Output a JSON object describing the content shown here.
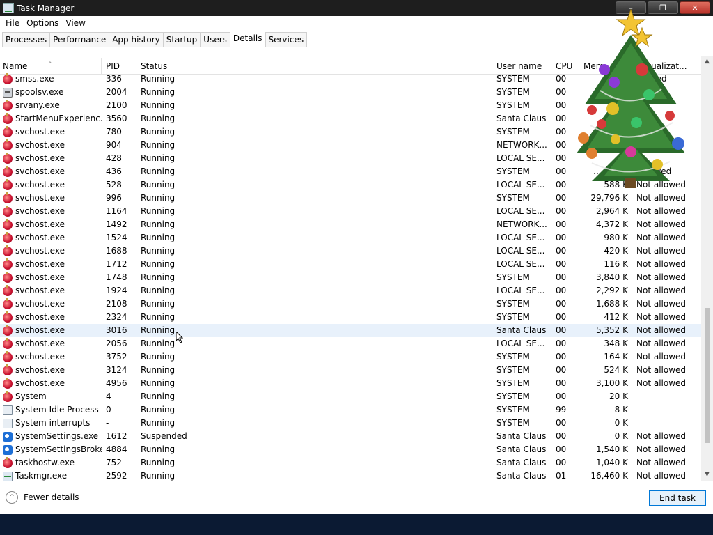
{
  "window": {
    "title": "Task Manager",
    "buttons": {
      "minimize": "–",
      "maximize": "❐",
      "close": "✕"
    }
  },
  "menu": [
    "File",
    "Options",
    "View"
  ],
  "tabs": [
    "Processes",
    "Performance",
    "App history",
    "Startup",
    "Users",
    "Details",
    "Services"
  ],
  "active_tab": "Details",
  "columns": {
    "name": "Name",
    "pid": "PID",
    "status": "Status",
    "user": "User name",
    "cpu": "CPU",
    "mem": "Mem",
    "virt": "...rtualizat..."
  },
  "rows": [
    {
      "icon": "app-icon",
      "name": "smss.exe",
      "pid": "336",
      "status": "Running",
      "user": "SYSTEM",
      "cpu": "00",
      "mem": "",
      "virt": "...owed"
    },
    {
      "icon": "printer-icon",
      "name": "spoolsv.exe",
      "pid": "2004",
      "status": "Running",
      "user": "SYSTEM",
      "cpu": "00",
      "mem": "",
      "virt": ""
    },
    {
      "icon": "app-icon",
      "name": "srvany.exe",
      "pid": "2100",
      "status": "Running",
      "user": "SYSTEM",
      "cpu": "00",
      "mem": "",
      "virt": ""
    },
    {
      "icon": "app-icon",
      "name": "StartMenuExperienc...",
      "pid": "3560",
      "status": "Running",
      "user": "Santa Claus",
      "cpu": "00",
      "mem": "",
      "virt": ""
    },
    {
      "icon": "app-icon",
      "name": "svchost.exe",
      "pid": "780",
      "status": "Running",
      "user": "SYSTEM",
      "cpu": "00",
      "mem": "",
      "virt": ""
    },
    {
      "icon": "app-icon",
      "name": "svchost.exe",
      "pid": "904",
      "status": "Running",
      "user": "NETWORK...",
      "cpu": "00",
      "mem": "",
      "virt": ""
    },
    {
      "icon": "app-icon",
      "name": "svchost.exe",
      "pid": "428",
      "status": "Running",
      "user": "LOCAL SE...",
      "cpu": "00",
      "mem": "",
      "virt": ""
    },
    {
      "icon": "app-icon",
      "name": "svchost.exe",
      "pid": "436",
      "status": "Running",
      "user": "SYSTEM",
      "cpu": "00",
      "mem": "...,136 K",
      "virt": "...llowed"
    },
    {
      "icon": "app-icon",
      "name": "svchost.exe",
      "pid": "528",
      "status": "Running",
      "user": "LOCAL SE...",
      "cpu": "00",
      "mem": "588 K",
      "virt": "Not allowed"
    },
    {
      "icon": "app-icon",
      "name": "svchost.exe",
      "pid": "996",
      "status": "Running",
      "user": "SYSTEM",
      "cpu": "00",
      "mem": "29,796 K",
      "virt": "Not allowed"
    },
    {
      "icon": "app-icon",
      "name": "svchost.exe",
      "pid": "1164",
      "status": "Running",
      "user": "LOCAL SE...",
      "cpu": "00",
      "mem": "2,964 K",
      "virt": "Not allowed"
    },
    {
      "icon": "app-icon",
      "name": "svchost.exe",
      "pid": "1492",
      "status": "Running",
      "user": "NETWORK...",
      "cpu": "00",
      "mem": "4,372 K",
      "virt": "Not allowed"
    },
    {
      "icon": "app-icon",
      "name": "svchost.exe",
      "pid": "1524",
      "status": "Running",
      "user": "LOCAL SE...",
      "cpu": "00",
      "mem": "980 K",
      "virt": "Not allowed"
    },
    {
      "icon": "app-icon",
      "name": "svchost.exe",
      "pid": "1688",
      "status": "Running",
      "user": "LOCAL SE...",
      "cpu": "00",
      "mem": "420 K",
      "virt": "Not allowed"
    },
    {
      "icon": "app-icon",
      "name": "svchost.exe",
      "pid": "1712",
      "status": "Running",
      "user": "LOCAL SE...",
      "cpu": "00",
      "mem": "116 K",
      "virt": "Not allowed"
    },
    {
      "icon": "app-icon",
      "name": "svchost.exe",
      "pid": "1748",
      "status": "Running",
      "user": "SYSTEM",
      "cpu": "00",
      "mem": "3,840 K",
      "virt": "Not allowed"
    },
    {
      "icon": "app-icon",
      "name": "svchost.exe",
      "pid": "1924",
      "status": "Running",
      "user": "LOCAL SE...",
      "cpu": "00",
      "mem": "2,292 K",
      "virt": "Not allowed"
    },
    {
      "icon": "app-icon",
      "name": "svchost.exe",
      "pid": "2108",
      "status": "Running",
      "user": "SYSTEM",
      "cpu": "00",
      "mem": "1,688 K",
      "virt": "Not allowed"
    },
    {
      "icon": "app-icon",
      "name": "svchost.exe",
      "pid": "2324",
      "status": "Running",
      "user": "SYSTEM",
      "cpu": "00",
      "mem": "412 K",
      "virt": "Not allowed"
    },
    {
      "icon": "app-icon",
      "name": "svchost.exe",
      "pid": "3016",
      "status": "Running",
      "user": "Santa Claus",
      "cpu": "00",
      "mem": "5,352 K",
      "virt": "Not allowed",
      "hover": true
    },
    {
      "icon": "app-icon",
      "name": "svchost.exe",
      "pid": "2056",
      "status": "Running",
      "user": "LOCAL SE...",
      "cpu": "00",
      "mem": "348 K",
      "virt": "Not allowed"
    },
    {
      "icon": "app-icon",
      "name": "svchost.exe",
      "pid": "3752",
      "status": "Running",
      "user": "SYSTEM",
      "cpu": "00",
      "mem": "164 K",
      "virt": "Not allowed"
    },
    {
      "icon": "app-icon",
      "name": "svchost.exe",
      "pid": "3124",
      "status": "Running",
      "user": "SYSTEM",
      "cpu": "00",
      "mem": "524 K",
      "virt": "Not allowed"
    },
    {
      "icon": "app-icon",
      "name": "svchost.exe",
      "pid": "4956",
      "status": "Running",
      "user": "SYSTEM",
      "cpu": "00",
      "mem": "3,100 K",
      "virt": "Not allowed"
    },
    {
      "icon": "app-icon",
      "name": "System",
      "pid": "4",
      "status": "Running",
      "user": "SYSTEM",
      "cpu": "00",
      "mem": "20 K",
      "virt": ""
    },
    {
      "icon": "system-icon",
      "name": "System Idle Process",
      "pid": "0",
      "status": "Running",
      "user": "SYSTEM",
      "cpu": "99",
      "mem": "8 K",
      "virt": ""
    },
    {
      "icon": "system-icon",
      "name": "System interrupts",
      "pid": "-",
      "status": "Running",
      "user": "SYSTEM",
      "cpu": "00",
      "mem": "0 K",
      "virt": ""
    },
    {
      "icon": "gear-icon",
      "name": "SystemSettings.exe",
      "pid": "1612",
      "status": "Suspended",
      "user": "Santa Claus",
      "cpu": "00",
      "mem": "0 K",
      "virt": "Not allowed"
    },
    {
      "icon": "gear-icon",
      "name": "SystemSettingsBroke...",
      "pid": "4884",
      "status": "Running",
      "user": "Santa Claus",
      "cpu": "00",
      "mem": "1,540 K",
      "virt": "Not allowed"
    },
    {
      "icon": "app-icon",
      "name": "taskhostw.exe",
      "pid": "752",
      "status": "Running",
      "user": "Santa Claus",
      "cpu": "00",
      "mem": "1,040 K",
      "virt": "Not allowed"
    },
    {
      "icon": "taskmgr-icon",
      "name": "Taskmgr.exe",
      "pid": "2592",
      "status": "Running",
      "user": "Santa Claus",
      "cpu": "01",
      "mem": "16,460 K",
      "virt": "Not allowed"
    }
  ],
  "footer": {
    "fewer_details": "Fewer details",
    "end_task": "End task"
  },
  "colors": {
    "titlebar": "#1e1e1e",
    "accent": "#0078d7",
    "hover_row": "#e8f1fb",
    "taskbar": "#0b1a33"
  }
}
